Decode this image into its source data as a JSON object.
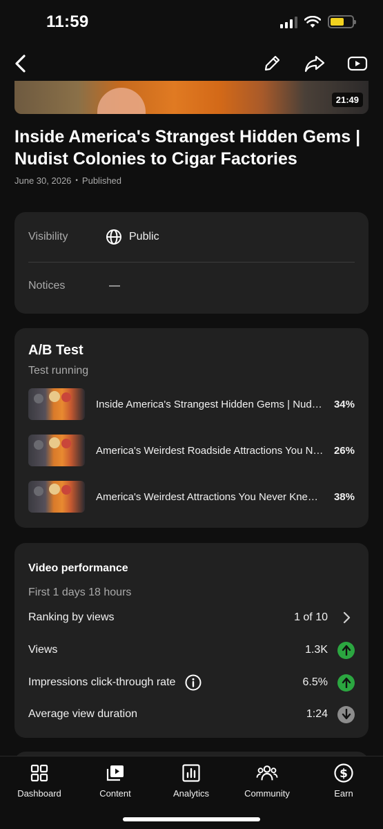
{
  "status_bar": {
    "time": "11:59"
  },
  "video": {
    "duration": "21:49",
    "title": "Inside America's Strangest Hidden Gems | Nudist Colonies to Cigar Factories",
    "date": "June 30, 2026",
    "state": "Published"
  },
  "details": {
    "visibility_label": "Visibility",
    "visibility_value": "Public",
    "notices_label": "Notices",
    "notices_value": "—"
  },
  "ab_test": {
    "title": "A/B Test",
    "status": "Test running",
    "variants": [
      {
        "title": "Inside America's Strangest Hidden Gems | Nudist Colonies to Cigar Factories",
        "percent": "34%"
      },
      {
        "title": "America's Weirdest Roadside Attractions You Never Knew Existed",
        "percent": "26%"
      },
      {
        "title": "America's Weirdest Attractions You Never Knew Existed",
        "percent": "38%"
      }
    ]
  },
  "performance": {
    "title": "Video performance",
    "period": "First 1 days 18 hours",
    "rows": [
      {
        "label": "Ranking by views",
        "value": "1 of 10",
        "trail": "chevron-right-icon"
      },
      {
        "label": "Views",
        "value": "1.3K",
        "trail": "arrow-up-icon"
      },
      {
        "label": "Impressions click-through rate",
        "value": "6.5%",
        "trail": "arrow-up-icon"
      },
      {
        "label": "Average view duration",
        "value": "1:24",
        "trail": "arrow-down-icon"
      }
    ],
    "colors": {
      "up": "#2ba640",
      "down": "#8c8c8c"
    }
  },
  "bottom_nav": {
    "items": [
      {
        "label": "Dashboard",
        "icon": "dashboard-icon"
      },
      {
        "label": "Content",
        "icon": "content-icon"
      },
      {
        "label": "Analytics",
        "icon": "analytics-icon"
      },
      {
        "label": "Community",
        "icon": "community-icon"
      },
      {
        "label": "Earn",
        "icon": "earn-icon"
      }
    ]
  }
}
